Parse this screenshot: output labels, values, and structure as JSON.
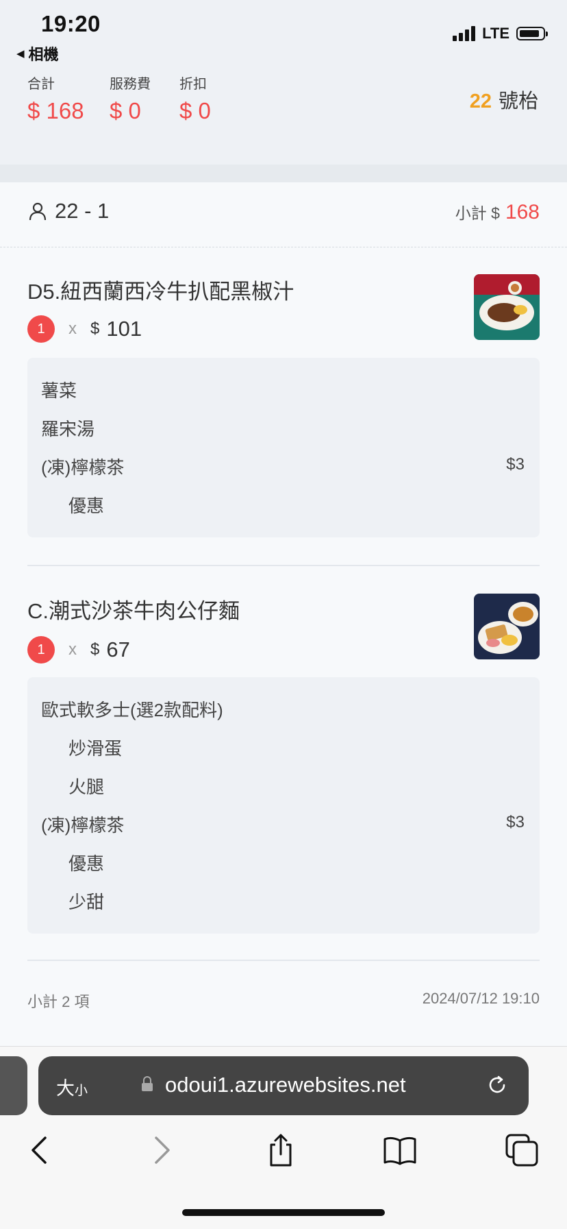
{
  "status_bar": {
    "time": "19:20",
    "back_app": "相機",
    "network": "LTE"
  },
  "header": {
    "totals": [
      {
        "label": "合計",
        "value": "$ 168"
      },
      {
        "label": "服務費",
        "value": "$ 0"
      },
      {
        "label": "折扣",
        "value": "$ 0"
      }
    ],
    "table_number": "22",
    "table_suffix": "號枱"
  },
  "order": {
    "guest": "22 - 1",
    "subtotal_label": "小計 $",
    "subtotal_amount": "168",
    "items": [
      {
        "title": "D5.紐西蘭西冷牛扒配黑椒汁",
        "qty": "1",
        "x": "x",
        "currency": "$",
        "price": "101",
        "options": [
          {
            "text": "薯菜",
            "indent": false,
            "price": ""
          },
          {
            "text": "羅宋湯",
            "indent": false,
            "price": ""
          },
          {
            "text": "(凍)檸檬茶",
            "indent": false,
            "price": "$3"
          },
          {
            "text": "優惠",
            "indent": true,
            "price": ""
          }
        ]
      },
      {
        "title": "C.潮式沙茶牛肉公仔麵",
        "qty": "1",
        "x": "x",
        "currency": "$",
        "price": "67",
        "options": [
          {
            "text": "歐式軟多士(選2款配料)",
            "indent": false,
            "price": ""
          },
          {
            "text": "炒滑蛋",
            "indent": true,
            "price": ""
          },
          {
            "text": "火腿",
            "indent": true,
            "price": ""
          },
          {
            "text": "(凍)檸檬茶",
            "indent": false,
            "price": "$3"
          },
          {
            "text": "優惠",
            "indent": true,
            "price": ""
          },
          {
            "text": "少甜",
            "indent": true,
            "price": ""
          }
        ]
      }
    ],
    "footer_count": "小計 2 項",
    "footer_datetime": "2024/07/12 19:10"
  },
  "browser": {
    "text_size": "大",
    "text_size_small": "小",
    "url": "odoui1.azurewebsites.net"
  },
  "colors": {
    "accent_red": "#f04a4a",
    "accent_orange": "#f0a020"
  },
  "icons": [
    "person-icon",
    "lock-icon",
    "reload-icon",
    "back-icon",
    "forward-icon",
    "share-icon",
    "bookmarks-icon",
    "tabs-icon"
  ]
}
